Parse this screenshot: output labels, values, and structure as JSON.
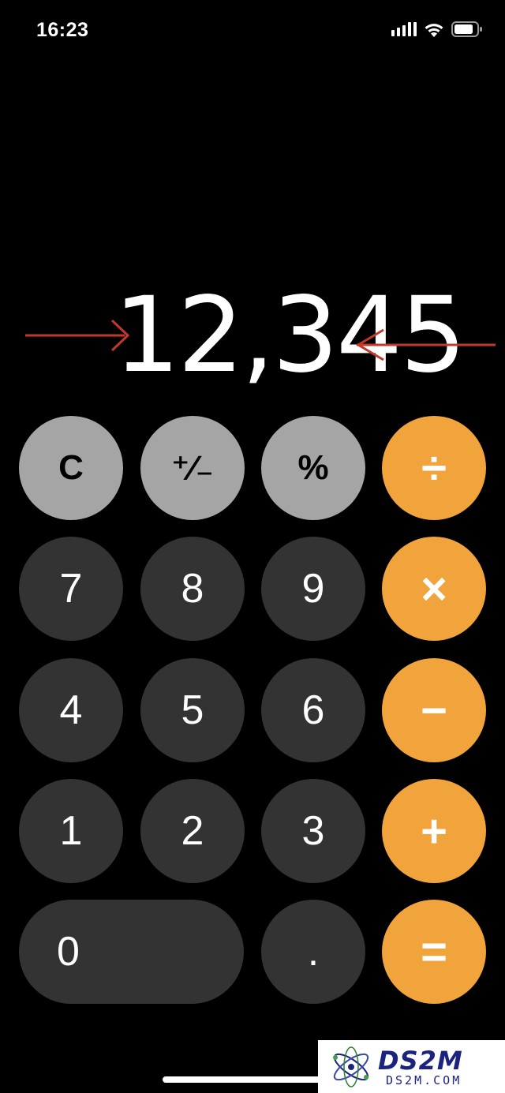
{
  "status_bar": {
    "time": "16:23",
    "icons": [
      "cellular-signal-icon",
      "wifi-icon",
      "battery-icon"
    ]
  },
  "display": {
    "value": "12,345"
  },
  "annotations": {
    "arrow_color": "#c0392b"
  },
  "keys": {
    "clear": "C",
    "plus_minus": "⁺∕₋",
    "percent": "%",
    "divide": "÷",
    "seven": "7",
    "eight": "8",
    "nine": "9",
    "multiply": "×",
    "four": "4",
    "five": "5",
    "six": "6",
    "minus": "−",
    "one": "1",
    "two": "2",
    "three": "3",
    "plus": "+",
    "zero": "0",
    "decimal": ".",
    "equals": "="
  },
  "colors": {
    "background": "#000000",
    "function_key": "#a5a5a5",
    "number_key": "#333333",
    "operator_key": "#f1a33c"
  },
  "watermark": {
    "main": "DS2M",
    "sub": "DS2M.COM"
  }
}
